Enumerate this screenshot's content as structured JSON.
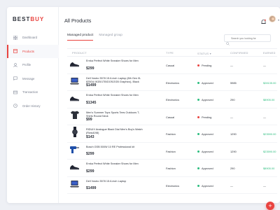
{
  "logo": {
    "part1": "BEST",
    "part2": "BUY"
  },
  "colors": {
    "accent": "#e9433f",
    "approved": "#2bbd7e",
    "pending": "#e9433f"
  },
  "sidebar": {
    "items": [
      {
        "label": "Dashboard",
        "icon": "grid-icon"
      },
      {
        "label": "Products",
        "icon": "box-icon",
        "active": true
      },
      {
        "label": "Profile",
        "icon": "user-icon"
      },
      {
        "label": "Message",
        "icon": "chat-icon"
      },
      {
        "label": "Transaction",
        "icon": "card-icon"
      },
      {
        "label": "Order History",
        "icon": "clock-icon"
      }
    ]
  },
  "header": {
    "title": "All Products"
  },
  "tabs": [
    {
      "label": "Managed product",
      "active": true
    },
    {
      "label": "Managed group"
    }
  ],
  "search": {
    "placeholder": "Search you looking for"
  },
  "table": {
    "headers": [
      "PRODUCT",
      "TYPE",
      "STATUS",
      "CONFIRMED",
      "EARNED"
    ],
    "rows": [
      {
        "name": "Ernka Perfect White Sneaker Shoes for Men",
        "price": "$299",
        "type": "Casual",
        "status": "Pending",
        "confirmed": "—",
        "earned": "—",
        "thumb": "shoe-icon"
      },
      {
        "name": "Dell Vostro 3578 15.6-inch Laptop (8th Gen i5-8250U/ 8GB/1TB/DOS/2GB Graphics), Black",
        "price": "$1499",
        "type": "Electronics",
        "status": "Approved",
        "confirmed": "5985",
        "earned": "$28135.00",
        "thumb": "laptop-icon"
      },
      {
        "name": "Ernka Perfect White Sneaker Shoes for Men",
        "price": "$1345",
        "type": "Electronics",
        "status": "Approved",
        "confirmed": "290",
        "earned": "$8905.00",
        "thumb": "shoe-icon"
      },
      {
        "name": "Men's Summer Tops Sports Tees Outdoors T-Shirts Round Neck",
        "price": "$99",
        "type": "Casual",
        "status": "Pending",
        "confirmed": "—",
        "earned": "—",
        "thumb": "tshirt-icon"
      },
      {
        "name": "RIDUIX Analogue Black Dial Men's Boy's Watch (Rwsd198)",
        "price": "$143",
        "type": "Fashion",
        "status": "Approved",
        "confirmed": "1290",
        "earned": "$23590.00",
        "thumb": "watch-icon"
      },
      {
        "name": "Bosch GSB 500W 10 RE Professional kit",
        "price": "$299",
        "type": "Fashion",
        "status": "Approved",
        "confirmed": "1290",
        "earned": "$23590.00",
        "thumb": "drill-icon"
      },
      {
        "name": "Ernka Perfect White Sneaker Shoes for Men",
        "price": "$299",
        "type": "Fashion",
        "status": "Approved",
        "confirmed": "290",
        "earned": "$8905.00",
        "thumb": "shoe-icon"
      },
      {
        "name": "Dell Vostro 3578 15.6-inch Laptop",
        "price": "$1499",
        "type": "Electronics",
        "status": "Approved",
        "confirmed": "—",
        "earned": "—",
        "thumb": "laptop-icon"
      }
    ]
  },
  "fab": {
    "label": "+"
  }
}
